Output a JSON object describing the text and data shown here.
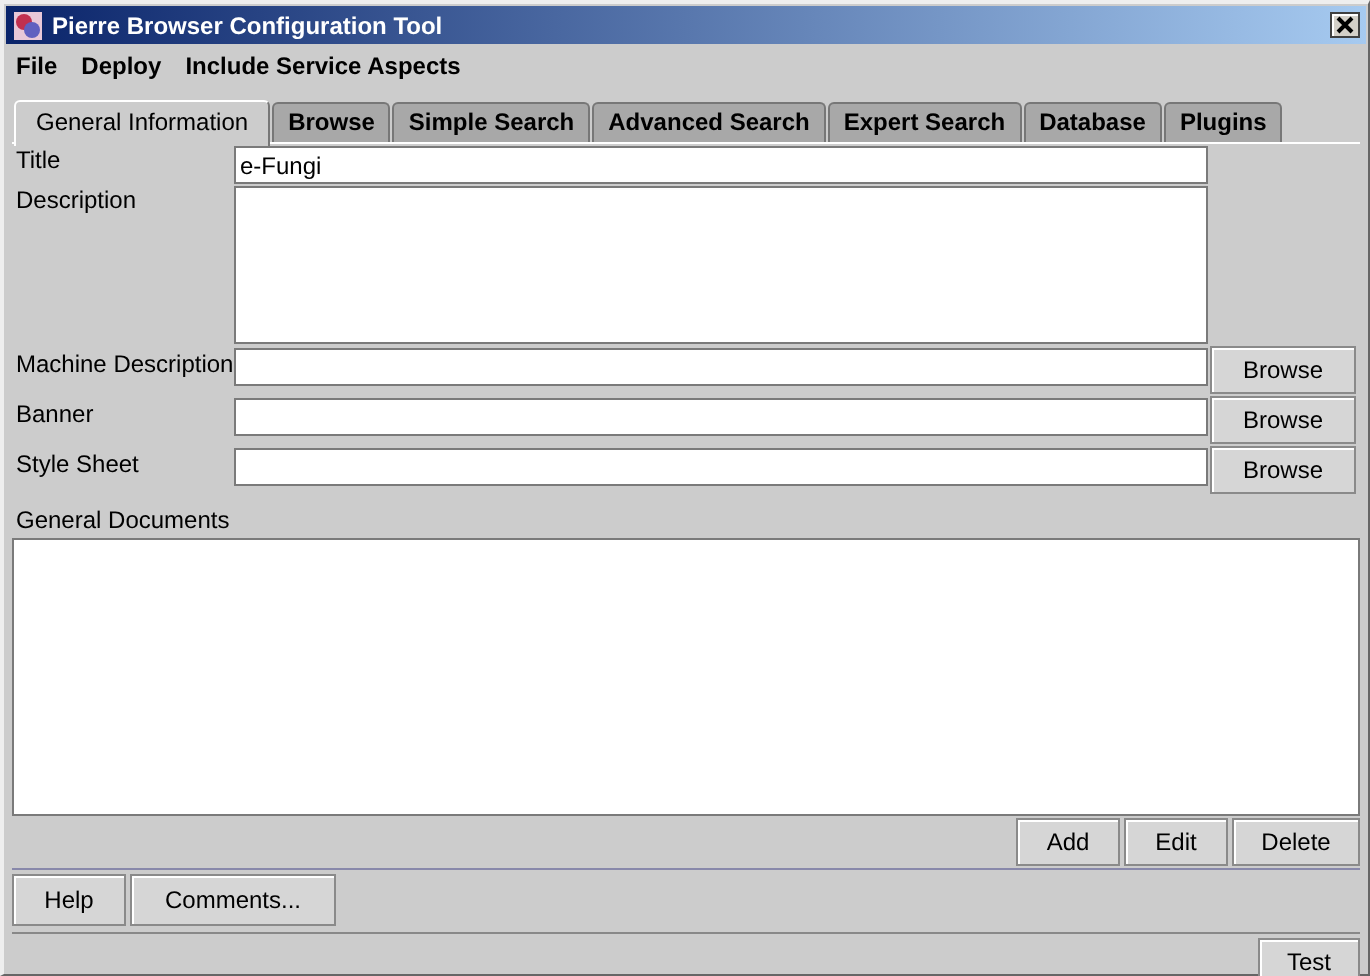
{
  "window": {
    "title": "Pierre Browser Configuration Tool"
  },
  "menu": [
    "File",
    "Deploy",
    "Include Service Aspects"
  ],
  "tabs": [
    {
      "label": "General Information",
      "selected": true
    },
    {
      "label": "Browse",
      "selected": false
    },
    {
      "label": "Simple Search",
      "selected": false
    },
    {
      "label": "Advanced Search",
      "selected": false
    },
    {
      "label": "Expert Search",
      "selected": false
    },
    {
      "label": "Database",
      "selected": false
    },
    {
      "label": "Plugins",
      "selected": false
    }
  ],
  "fields": [
    {
      "label": "Title",
      "kind": "text",
      "value": "e-Fungi"
    },
    {
      "label": "Description",
      "kind": "textarea"
    },
    {
      "label": "Machine Description",
      "kind": "browse",
      "button": "Browse"
    },
    {
      "label": "Banner",
      "kind": "browse",
      "button": "Browse"
    },
    {
      "label": "Style Sheet",
      "kind": "browse",
      "button": "Browse"
    }
  ],
  "documents": {
    "label": "General Documents",
    "buttons": [
      "Add",
      "Edit",
      "Delete"
    ]
  },
  "footer_buttons": [
    "Help",
    "Comments..."
  ],
  "test_button": "Test"
}
